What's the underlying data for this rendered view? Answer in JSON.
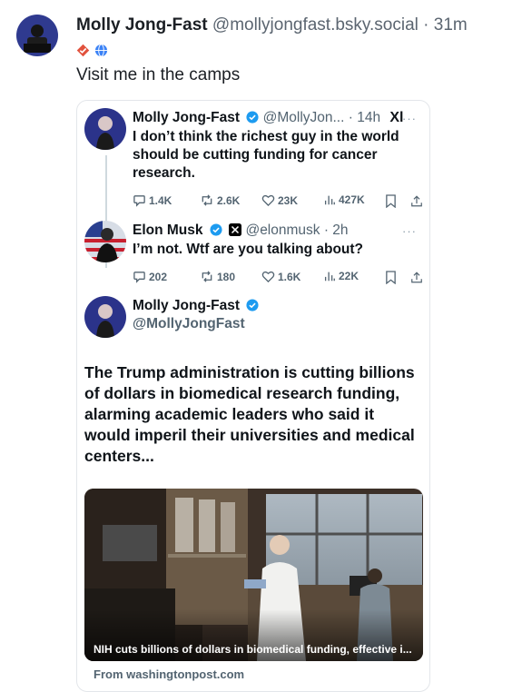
{
  "post": {
    "author": "Molly Jong-Fast",
    "handle": "@mollyjongfast.bsky.social",
    "separator": "·",
    "time": "31m",
    "text": "Visit me in the camps"
  },
  "embed": {
    "tweet1": {
      "name": "Molly Jong-Fast",
      "meta": "@MollyJon... · 14h",
      "x_mark": "Xl",
      "text": "I don’t think the richest guy in the world should be cutting funding for cancer research.",
      "stats": {
        "replies": "1.4K",
        "reposts": "2.6K",
        "likes": "23K",
        "views": "427K"
      }
    },
    "tweet2": {
      "name": "Elon Musk",
      "meta": "@elonmusk · 2h",
      "text": "I’m not. Wtf are you talking about?",
      "stats": {
        "replies": "202",
        "reposts": "180",
        "likes": "1.6K",
        "views": "22K"
      }
    },
    "quoted": {
      "name": "Molly Jong-Fast",
      "handle": "@MollyJongFast",
      "text": "The Trump administration is cutting billions of dollars in biomedical research funding, alarming academic leaders who said it would imperil their universities and medical centers...",
      "article_caption": "NIH cuts billions of dollars in biomedical funding, effective i...",
      "source": "From washingtonpost.com"
    }
  },
  "colors": {
    "verified": "#1d9bf0",
    "bluesky_badge": "#e1523d",
    "globe": "#3b82f6"
  }
}
